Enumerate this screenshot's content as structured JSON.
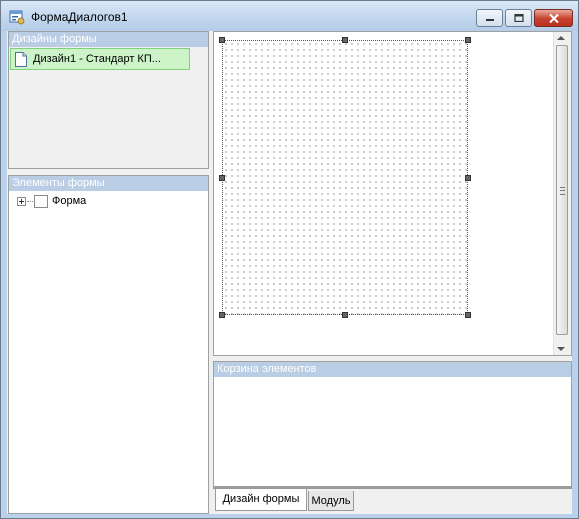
{
  "window": {
    "title": "ФормаДиалогов1",
    "buttons": {
      "minimize": "minimize",
      "maximize": "maximize",
      "close": "close"
    }
  },
  "designs_panel": {
    "header": "Дизайны формы",
    "items": [
      {
        "label": "Дизайн1 - Стандарт КП..."
      }
    ]
  },
  "elements_panel": {
    "header": "Элементы формы",
    "tree": [
      {
        "label": "Форма",
        "expanded": false
      }
    ]
  },
  "basket_panel": {
    "header": "Корзина элементов"
  },
  "tabs": [
    {
      "label": "Дизайн формы",
      "active": true
    },
    {
      "label": "Модуль",
      "active": false
    }
  ],
  "icons": {
    "app": "dialog-form-icon",
    "design_item": "document-icon",
    "tree_node": "form-icon",
    "expand": "plus-expander-icon"
  },
  "colors": {
    "selection_bg": "#cdf3c8",
    "header_bg": "#b9cde5",
    "close_button": "#c7412e"
  }
}
